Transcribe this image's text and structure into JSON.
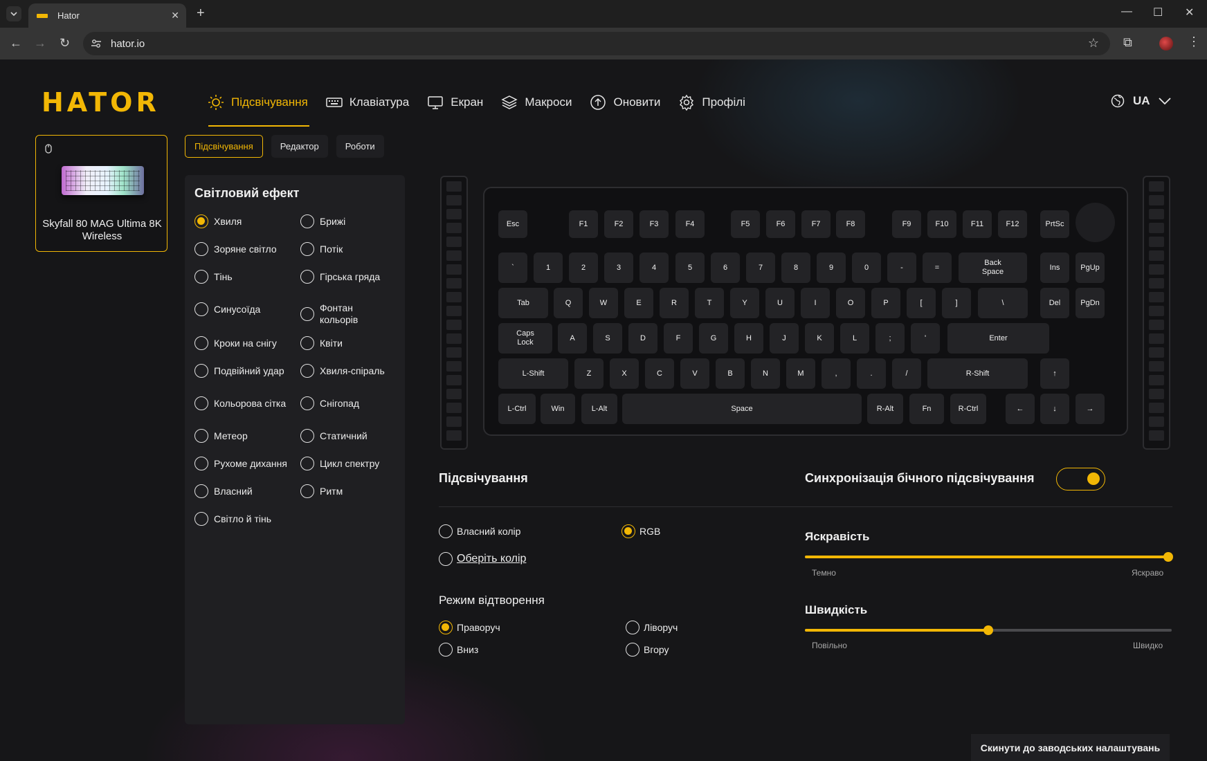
{
  "browser": {
    "tab_title": "Hator",
    "url": "hator.io"
  },
  "app": {
    "logo": "HATOR",
    "nav": [
      {
        "label": "Підсвічування",
        "icon": "sun-icon",
        "active": true
      },
      {
        "label": "Клавіатура",
        "icon": "keyboard-icon",
        "active": false
      },
      {
        "label": "Екран",
        "icon": "monitor-icon",
        "active": false
      },
      {
        "label": "Макроси",
        "icon": "layers-icon",
        "active": false
      },
      {
        "label": "Оновити",
        "icon": "upload-icon",
        "active": false
      },
      {
        "label": "Профілі",
        "icon": "gear-icon",
        "active": false
      }
    ],
    "language": "UA",
    "device": {
      "name": "Skyfall 80 MAG Ultima 8K Wireless"
    },
    "subtabs": [
      {
        "label": "Підсвічування",
        "active": true
      },
      {
        "label": "Редактор",
        "active": false
      },
      {
        "label": "Роботи",
        "active": false
      }
    ],
    "effects": {
      "title": "Світловий ефект",
      "selected": "Хвиля",
      "left": [
        "Хвиля",
        "Зоряне світло",
        "Тінь",
        "Синусоїда",
        "Кроки на снігу",
        "Подвійний удар",
        "Кольорова сітка",
        "Метеор",
        "Рухоме дихання",
        "Власний",
        "Світло й тінь"
      ],
      "right": [
        "Брижі",
        "Потік",
        "Гірська гряда",
        "Фонтан кольорів",
        "Квіти",
        "Хвиля-спіраль",
        "Снігопад",
        "Статичний",
        "Цикл спектру",
        "Ритм"
      ]
    },
    "keyboard": {
      "rows": [
        [
          "Esc",
          "F1",
          "F2",
          "F3",
          "F4",
          "F5",
          "F6",
          "F7",
          "F8",
          "F9",
          "F10",
          "F11",
          "F12",
          "PrtSc"
        ],
        [
          "`",
          "1",
          "2",
          "3",
          "4",
          "5",
          "6",
          "7",
          "8",
          "9",
          "0",
          "-",
          "=",
          "Back\nSpace",
          "Ins",
          "PgUp"
        ],
        [
          "Tab",
          "Q",
          "W",
          "E",
          "R",
          "T",
          "Y",
          "U",
          "I",
          "O",
          "P",
          "[",
          "]",
          "\\",
          "Del",
          "PgDn"
        ],
        [
          "Caps\nLock",
          "A",
          "S",
          "D",
          "F",
          "G",
          "H",
          "J",
          "K",
          "L",
          ";",
          "'",
          "Enter"
        ],
        [
          "L-Shift",
          "Z",
          "X",
          "C",
          "V",
          "B",
          "N",
          "M",
          ",",
          ".",
          "/",
          "R-Shift",
          "↑"
        ],
        [
          "L-Ctrl",
          "Win",
          "L-Alt",
          "Space",
          "R-Alt",
          "Fn",
          "R-Ctrl",
          "←",
          "↓",
          "→"
        ]
      ]
    },
    "lighting": {
      "title": "Підсвічування",
      "color_own": "Власний колір",
      "color_rgb": "RGB",
      "choose_color": "Оберіть колір",
      "color_selected": "RGB",
      "sync_title": "Синхронізація бічного підсвічування",
      "sync_on": true,
      "brightness": {
        "label": "Яскравість",
        "min_label": "Темно",
        "max_label": "Яскраво",
        "value_pct": 99
      },
      "speed": {
        "label": "Швидкість",
        "min_label": "Повільно",
        "max_label": "Швидко",
        "value_pct": 50
      },
      "mode_title": "Режим відтворення",
      "modes": [
        "Праворуч",
        "Ліворуч",
        "Вниз",
        "Вгору"
      ],
      "mode_selected": "Праворуч",
      "reset": "Скинути до заводських налаштувань"
    },
    "accent_color": "#f2b705"
  }
}
